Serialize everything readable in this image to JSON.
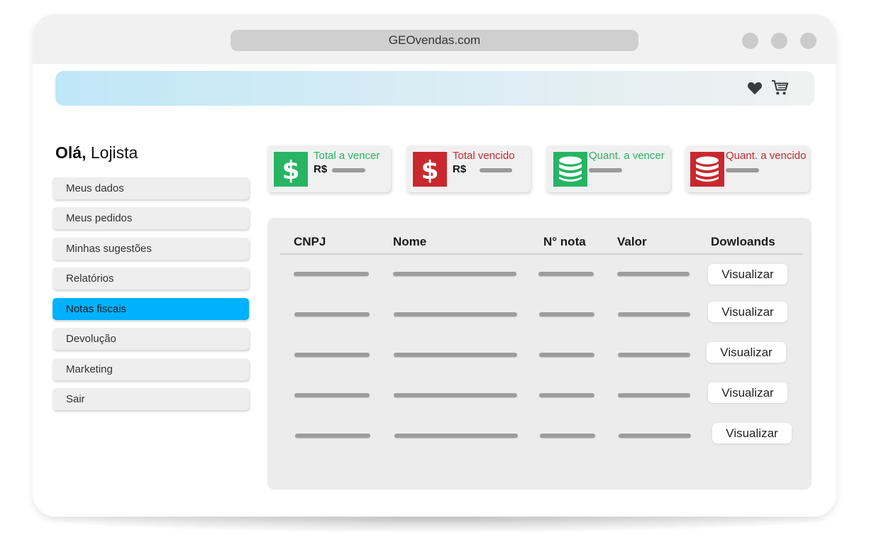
{
  "browser": {
    "url": "GEOvendas.com"
  },
  "header": {
    "icons": [
      "heart-icon",
      "cart-icon"
    ]
  },
  "greeting": {
    "bold": "Olá,",
    "name": "Lojista"
  },
  "sidebar": {
    "items": [
      {
        "label": "Meus dados"
      },
      {
        "label": "Meus pedidos"
      },
      {
        "label": "Minhas sugestões"
      },
      {
        "label": "Relatórios"
      },
      {
        "label": "Notas fiscais",
        "active": true
      },
      {
        "label": "Devolução"
      },
      {
        "label": "Marketing"
      },
      {
        "label": "Sair"
      }
    ]
  },
  "cards": [
    {
      "label": "Total a vencer",
      "prefix": "R$",
      "icon": "dollar-icon",
      "color": "#27b463"
    },
    {
      "label": "Total vencido",
      "prefix": "R$",
      "icon": "dollar-icon",
      "color": "#c9282e"
    },
    {
      "label": "Quant. a vencer",
      "icon": "database-icon",
      "color": "#27b463"
    },
    {
      "label": "Quant. a vencido",
      "icon": "database-icon",
      "color": "#c9282e"
    }
  ],
  "table": {
    "columns": [
      "CNPJ",
      "Nome",
      "N° nota",
      "Valor",
      "Dowloands"
    ],
    "rows": [
      {
        "action": "Visualizar"
      },
      {
        "action": "Visualizar"
      },
      {
        "action": "Visualizar"
      },
      {
        "action": "Visualizar"
      },
      {
        "action": "Visualizar"
      }
    ]
  },
  "colors": {
    "active_menu": "#00b1ff",
    "positive": "#27b463",
    "negative": "#c9282e"
  }
}
